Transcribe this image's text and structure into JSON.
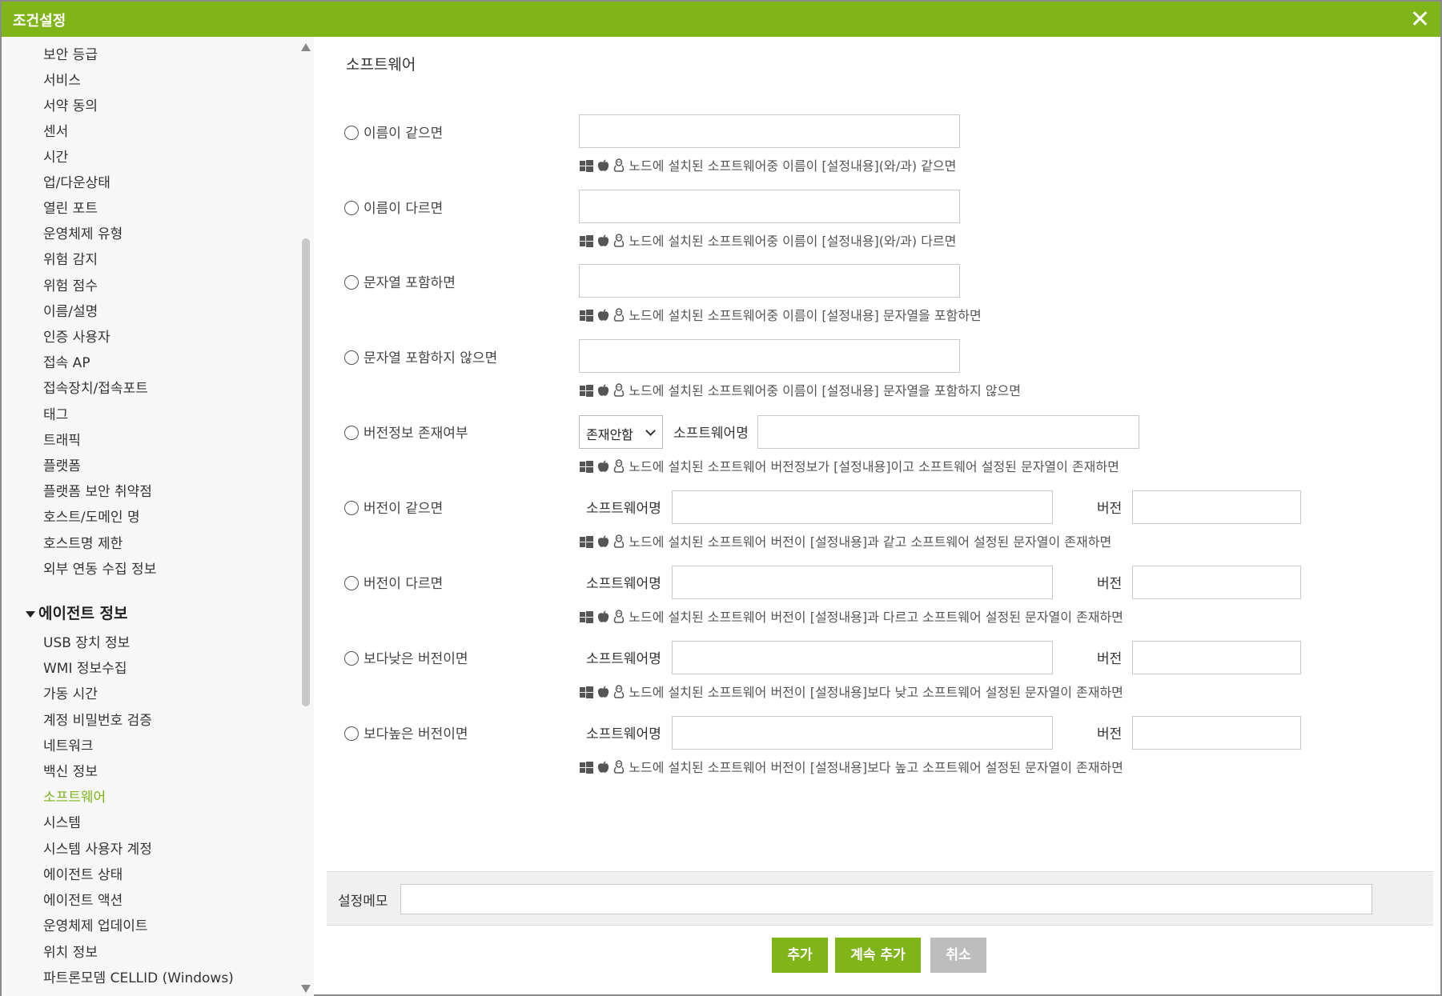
{
  "dialog": {
    "title": "조건설정"
  },
  "sidebar": {
    "items": [
      {
        "label": "보안 등급"
      },
      {
        "label": "서비스"
      },
      {
        "label": "서약 동의"
      },
      {
        "label": "센서"
      },
      {
        "label": "시간"
      },
      {
        "label": "업/다운상태"
      },
      {
        "label": "열린 포트"
      },
      {
        "label": "운영체제 유형"
      },
      {
        "label": "위험 감지"
      },
      {
        "label": "위험 점수"
      },
      {
        "label": "이름/설명"
      },
      {
        "label": "인증 사용자"
      },
      {
        "label": "접속 AP"
      },
      {
        "label": "접속장치/접속포트"
      },
      {
        "label": "태그"
      },
      {
        "label": "트래픽"
      },
      {
        "label": "플랫폼"
      },
      {
        "label": "플랫폼 보안 취약점"
      },
      {
        "label": "호스트/도메인 명"
      },
      {
        "label": "호스트명 제한"
      },
      {
        "label": "외부 연동 수집 정보"
      }
    ],
    "group": {
      "label": "에이전트 정보"
    },
    "group_items": [
      {
        "label": "USB 장치 정보"
      },
      {
        "label": "WMI 정보수집"
      },
      {
        "label": "가동 시간"
      },
      {
        "label": "계정 비밀번호 검증"
      },
      {
        "label": "네트워크"
      },
      {
        "label": "백신 정보"
      },
      {
        "label": "소프트웨어",
        "active": true
      },
      {
        "label": "시스템"
      },
      {
        "label": "시스템 사용자 계정"
      },
      {
        "label": "에이전트 상태"
      },
      {
        "label": "에이전트 액션"
      },
      {
        "label": "운영체제 업데이트"
      },
      {
        "label": "위치 정보"
      },
      {
        "label": "파트론모뎀 CELLID (Windows)"
      }
    ]
  },
  "main": {
    "section_title": "소프트웨어",
    "conditions": [
      {
        "label": "이름이 같으면",
        "desc": "노드에 설치된 소프트웨어중 이름이 [설정내용](와/과) 같으면"
      },
      {
        "label": "이름이 다르면",
        "desc": "노드에 설치된 소프트웨어중 이름이 [설정내용](와/과) 다르면"
      },
      {
        "label": "문자열 포함하면",
        "desc": "노드에 설치된 소프트웨어중 이름이 [설정내용] 문자열을 포함하면"
      },
      {
        "label": "문자열 포함하지 않으면",
        "desc": "노드에 설치된 소프트웨어중 이름이 [설정내용] 문자열을 포함하지 않으면"
      },
      {
        "label": "버전정보 존재여부",
        "desc": "노드에 설치된 소프트웨어 버전정보가 [설정내용]이고 소프트웨어 설정된 문자열이 존재하면",
        "select_value": "존재안함",
        "software_label": "소프트웨어명"
      },
      {
        "label": "버전이 같으면",
        "desc": "노드에 설치된 소프트웨어 버전이 [설정내용]과 같고 소프트웨어 설정된 문자열이 존재하면",
        "software_label": "소프트웨어명",
        "version_label": "버전"
      },
      {
        "label": "버전이 다르면",
        "desc": "노드에 설치된 소프트웨어 버전이 [설정내용]과 다르고 소프트웨어 설정된 문자열이 존재하면",
        "software_label": "소프트웨어명",
        "version_label": "버전"
      },
      {
        "label": "보다낮은 버전이면",
        "desc": "노드에 설치된 소프트웨어 버전이 [설정내용]보다 낮고 소프트웨어 설정된 문자열이 존재하면",
        "software_label": "소프트웨어명",
        "version_label": "버전"
      },
      {
        "label": "보다높은 버전이면",
        "desc": "노드에 설치된 소프트웨어 버전이 [설정내용]보다 높고 소프트웨어 설정된 문자열이 존재하면",
        "software_label": "소프트웨어명",
        "version_label": "버전"
      }
    ],
    "memo_label": "설정메모",
    "buttons": {
      "add": "추가",
      "add_continue": "계속 추가",
      "cancel": "취소"
    }
  },
  "colors": {
    "accent": "#7fb518",
    "disabled": "#bdbdbd"
  },
  "icons": [
    "windows-icon",
    "apple-icon",
    "linux-icon"
  ]
}
